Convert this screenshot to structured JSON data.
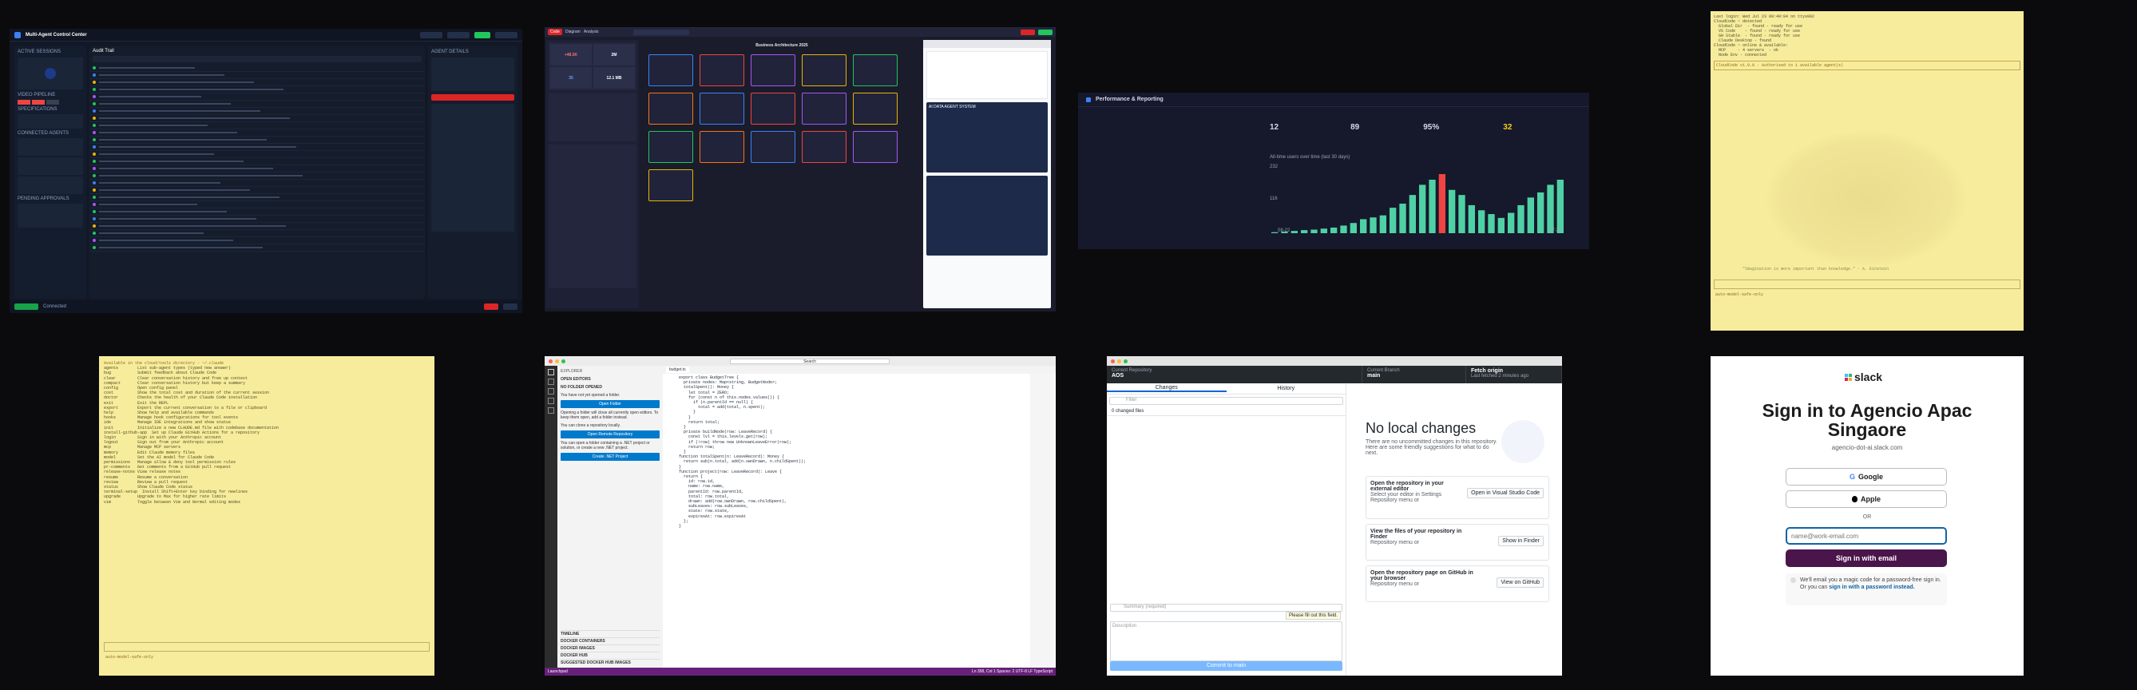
{
  "t1": {
    "title": "Multi-Agent Control Center",
    "left_top": "ACTIVE SESSIONS",
    "left_items": [
      "VIDEO PIPELINE",
      "SPECIFICATIONS",
      "CONNECTED AGENTS",
      "PENDING APPROVALS"
    ],
    "mid_header": "Audit Trail",
    "log_rows": 26,
    "right_header": "AGENT DETAILS",
    "bottom_label": "Connected"
  },
  "t2": {
    "title": "Business Architecture 2025",
    "tabs": [
      "Code",
      "Diagram",
      "Analysis"
    ],
    "stats": [
      {
        "value": "+48.5K",
        "label": ""
      },
      {
        "value": "2M",
        "label": ""
      },
      {
        "value": "35",
        "label": ""
      },
      {
        "value": "12.1 MB",
        "label": ""
      }
    ],
    "right_header": "AI DATA AGENT SYSTEM"
  },
  "t3": {
    "title": "Performance & Reporting",
    "stats": [
      {
        "value": "12",
        "label": ""
      },
      {
        "value": "89",
        "label": ""
      },
      {
        "value": "95%",
        "label": ""
      },
      {
        "value": "32",
        "label": ""
      }
    ],
    "chart_label": "All-time users over time (last 30 days)",
    "y_top": "232",
    "y_mid": "116",
    "x_start": "08-22",
    "x_end": "07-31"
  },
  "chart_data": {
    "type": "bar",
    "title": "",
    "values": [
      4,
      6,
      9,
      12,
      14,
      18,
      22,
      30,
      40,
      55,
      62,
      70,
      100,
      116,
      150,
      190,
      210,
      232,
      170,
      150,
      110,
      90,
      75,
      60,
      80,
      110,
      140,
      160,
      190,
      210
    ],
    "ylim": [
      0,
      232
    ]
  },
  "t4": {
    "lines": [
      "Last login: Wed Jul 23 09:49:04 on ttys002",
      "CloudCode ~ detected",
      "  Global Dir  - found - ready for use",
      "  VS Code    - found - ready for use",
      "  GH Stable  - found - ready for use",
      "  Claude Desktop - found",
      "CloudCode ~ online & available:",
      "  MCP     - 4 servers  - ok",
      "  Node Env - connected"
    ],
    "box_line": "CloudCode v1.0.0 - Authorised to 1 available agent(s)",
    "quote": "\"Imagination is more important than knowledge.\" - A. Einstein",
    "prompt": "auto-model-safe-only"
  },
  "t5": {
    "header": "Available in the cloud/tools directory - ~/.claude",
    "lines": [
      "agents        List sub-agent types (typed new answer)",
      "bug           Submit feedback about Claude Code",
      "clear         Clear conversation history and free up context",
      "compact       Clear conversation history but keep a summary",
      "config        Open config panel",
      "cost          Show the total cost and duration of the current session",
      "doctor        Checks the health of your Claude Code installation",
      "exit          Exit the REPL",
      "export        Export the current conversation to a file or clipboard",
      "help          Show help and available commands",
      "hooks         Manage hook configurations for tool events",
      "ide           Manage IDE integrations and show status",
      "init          Initialize a new CLAUDE.md file with codebase documentation",
      "install-github-app  Set up Claude GitHub Actions for a repository",
      "login         Sign in with your Anthropic account",
      "logout        Sign out from your Anthropic account",
      "mcp           Manage MCP servers",
      "memory        Edit Claude memory files",
      "model         Set the AI model for Claude Code",
      "permissions   Manage allow & deny tool permission rules",
      "pr-comments   Get comments from a GitHub pull request",
      "release-notes View release notes",
      "resume        Resume a conversation",
      "review        Review a pull request",
      "status        Show Claude Code status",
      "terminal-setup  Install Shift+Enter key binding for newlines",
      "upgrade       Upgrade to Max for higher rate limits",
      "vim           Toggle between Vim and Normal editing modes"
    ],
    "prompt": "auto-model-safe-only"
  },
  "t6": {
    "title": "Search",
    "explorer": "EXPLORER",
    "open_editors": "OPEN EDITORS",
    "no_folder": "NO FOLDER OPENED",
    "msg1": "You have not yet opened a folder.",
    "btn_open_folder": "Open Folder",
    "msg2": "Opening a folder will close all currently open editors. To keep them open, add a folder instead.",
    "msg3": "You can clone a repository locally.",
    "btn_remote": "Open Remote Repository",
    "msg4": "You can open a folder containing a .NET project or solution, or create a new .NET project.",
    "btn_dotnet": "Create .NET Project",
    "sections": [
      "TIMELINE",
      "DOCKER CONTAINERS",
      "DOCKER IMAGES",
      "DOCKER HUB",
      "SUGGESTED DOCKER HUB IMAGES"
    ],
    "file_tab": "budget.ts",
    "code": [
      "export class BudgetTree {",
      "  private nodes: Map<string, BudgetNode>;",
      "  totalSpent(): Money {",
      "    let total = ZERO;",
      "    for (const n of this.nodes.values()) {",
      "      if (n.parentId == null) {",
      "        total = add(total, n.spent);",
      "      }",
      "    }",
      "    return total;",
      "  }",
      "",
      "  private buildNode(row: LeaveRecord) {",
      "    const lvl = this.levels.get(row);",
      "    if (!row) throw new UnknownLeaveError(row);",
      "    return row;",
      "  }",
      "",
      "function totalSpent(n: LeaveRecord): Money {",
      "  return sub(n.total, add(n.ownDrawn, n.childSpent));",
      "}",
      "",
      "function project(row: LeaveRecord): Leave {",
      "  return {",
      "    id: row.id,",
      "    name: row.name,",
      "    parentId: row.parentId,",
      "    total: row.total,",
      "    drawn: add(row.ownDrawn, row.childSpent),",
      "    subLeaves: row.subLeaves,",
      "    state: row.state,",
      "    expiresAt: row.expiresAt",
      "  };",
      "}"
    ],
    "status_branch": "Launchpad",
    "status_right": "Ln 358, Col 1   Spaces: 2   UTF-8   LF   TypeScript"
  },
  "t7": {
    "repo_label": "Current Repository",
    "repo": "AOS",
    "branch_label": "Current Branch",
    "branch": "main",
    "fetch_label": "Fetch origin",
    "fetch_sub": "Last fetched 2 minutes ago",
    "tab_changes": "Changes",
    "tab_history": "History",
    "filter": "Filter",
    "changed": "0 changed files",
    "summary": "Summary (required)",
    "description": "Description",
    "tooltip": "Please fill out this field.",
    "commit": "Commit to main",
    "title": "No local changes",
    "subtitle": "There are no uncommitted changes in this repository. Here are some friendly suggestions for what to do next.",
    "card1_title": "Open the repository in your external editor",
    "card1_sub": "Select your editor in Settings",
    "card1_btn": "Open in Visual Studio Code",
    "card2_title": "View the files of your repository in Finder",
    "card2_btn": "Show in Finder",
    "card3_title": "Open the repository page on GitHub in your browser",
    "card3_btn": "View on GitHub",
    "repo_menu": "Repository menu or"
  },
  "t8": {
    "logo": "slack",
    "heading1": "Sign in to Agencio Apac",
    "heading2": "Singaore",
    "domain": "agencio-dot-ai.slack.com",
    "google": "Google",
    "apple": "Apple",
    "or": "OR",
    "email_placeholder": "name@work-email.com",
    "signin": "Sign in with email",
    "note": "We'll email you a magic code for a password-free sign in. Or you can",
    "note_link": "sign in with a password instead."
  }
}
